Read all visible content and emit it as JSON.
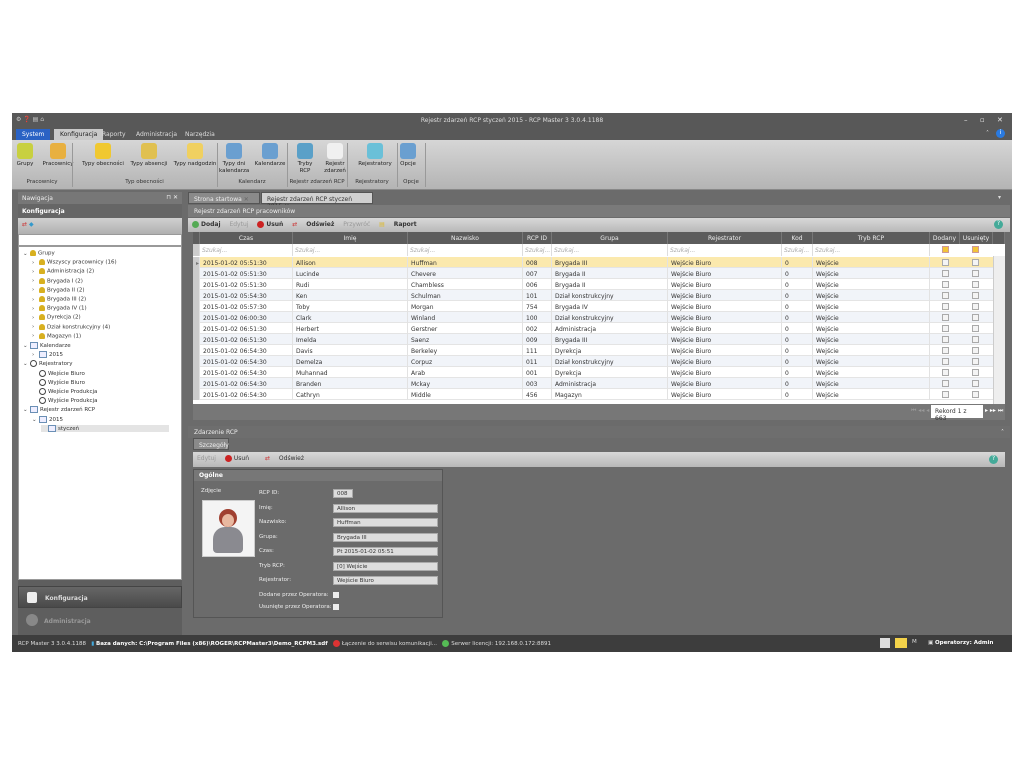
{
  "window": {
    "title": "Rejestr zdarzeń RCP styczeń 2015 - RCP Master 3 3.0.4.1188"
  },
  "ribbon": {
    "tabs": [
      "System",
      "Konfiguracja",
      "Raporty",
      "Administracja",
      "Narzędzia"
    ],
    "buttons": [
      {
        "label": "Grupy",
        "color": "#c8d040"
      },
      {
        "label": "Pracownicy",
        "color": "#e8b040"
      },
      {
        "label": "Typy obecności",
        "color": "#f0c830"
      },
      {
        "label": "Typy absencji",
        "color": "#e0c050"
      },
      {
        "label": "Typy nadgodzin",
        "color": "#f0d060"
      },
      {
        "label": "Typy dni kalendarza",
        "color": "#6a9fd0"
      },
      {
        "label": "Kalendarze",
        "color": "#6a9fd0"
      },
      {
        "label": "Tryby RCP",
        "color": "#5aa0c8"
      },
      {
        "label": "Rejestr zdarzeń",
        "color": "#f0f0f0"
      },
      {
        "label": "Rejestratory",
        "color": "#6ac0d8"
      },
      {
        "label": "Opcje",
        "color": "#6a9fd0"
      }
    ],
    "groups": [
      "Pracownicy",
      "Typ obecności",
      "Kalendarz",
      "Rejestr zdarzeń RCP",
      "Rejestratory",
      "Opcje"
    ]
  },
  "nav": {
    "title": "Nawigacja",
    "section": "Konfiguracja",
    "tree": [
      {
        "label": "Grupy",
        "level": 0,
        "icon": "users",
        "exp": "v"
      },
      {
        "label": "Wszyscy pracownicy (16)",
        "level": 1,
        "icon": "users",
        "exp": ">"
      },
      {
        "label": "Administracja (2)",
        "level": 1,
        "icon": "users",
        "exp": ">"
      },
      {
        "label": "Brygada I (2)",
        "level": 1,
        "icon": "users",
        "exp": ">"
      },
      {
        "label": "Brygada II (2)",
        "level": 1,
        "icon": "users",
        "exp": ">"
      },
      {
        "label": "Brygada III (2)",
        "level": 1,
        "icon": "users",
        "exp": ">"
      },
      {
        "label": "Brygada IV (1)",
        "level": 1,
        "icon": "users",
        "exp": ">"
      },
      {
        "label": "Dyrekcja (2)",
        "level": 1,
        "icon": "users",
        "exp": ">"
      },
      {
        "label": "Dział konstrukcyjny (4)",
        "level": 1,
        "icon": "users",
        "exp": ">"
      },
      {
        "label": "Magazyn (1)",
        "level": 1,
        "icon": "users",
        "exp": ">"
      },
      {
        "label": "Kalendarze",
        "level": 0,
        "icon": "calendar",
        "exp": "v"
      },
      {
        "label": "2015",
        "level": 1,
        "icon": "calendar",
        "exp": ">"
      },
      {
        "label": "Rejestratory",
        "level": 0,
        "icon": "reader",
        "exp": "v"
      },
      {
        "label": "Wejście Biuro",
        "level": 1,
        "icon": "reader",
        "exp": ""
      },
      {
        "label": "Wyjście Biuro",
        "level": 1,
        "icon": "reader",
        "exp": ""
      },
      {
        "label": "Wejście Produkcja",
        "level": 1,
        "icon": "reader",
        "exp": ""
      },
      {
        "label": "Wyjście Produkcja",
        "level": 1,
        "icon": "reader",
        "exp": ""
      },
      {
        "label": "Rejestr zdarzeń RCP",
        "level": 0,
        "icon": "calendar",
        "exp": "v"
      },
      {
        "label": "2015",
        "level": 1,
        "icon": "calendar",
        "exp": "v"
      },
      {
        "label": "styczeń",
        "level": 2,
        "icon": "calendar",
        "exp": ""
      }
    ],
    "bottom": [
      "Konfiguracja",
      "Administracja"
    ]
  },
  "tabs": [
    "Strona startowa",
    "Rejestr zdarzeń RCP styczeń 2015"
  ],
  "grid_section": "Rejestr zdarzeń RCP pracowników",
  "toolbar": {
    "add": "Dodaj",
    "edit": "Edytuj",
    "delete": "Usuń",
    "refresh": "Odśwież",
    "restore": "Przywróć",
    "report": "Raport"
  },
  "grid": {
    "columns": [
      "Czas",
      "Imię",
      "Nazwisko",
      "RCP ID",
      "Grupa",
      "Rejestrator",
      "Kod",
      "Tryb RCP",
      "Dodany",
      "Usunięty"
    ],
    "filter_placeholder": "Szukaj...",
    "rows": [
      [
        "2015-01-02 05:51:30",
        "Allison",
        "Huffman",
        "008",
        "Brygada III",
        "Wejście Biuro",
        "0",
        "Wejście"
      ],
      [
        "2015-01-02 05:51:30",
        "Lucinde",
        "Chevere",
        "007",
        "Brygada II",
        "Wejście Biuro",
        "0",
        "Wejście"
      ],
      [
        "2015-01-02 05:51:30",
        "Rudi",
        "Chambless",
        "006",
        "Brygada II",
        "Wejście Biuro",
        "0",
        "Wejście"
      ],
      [
        "2015-01-02 05:54:30",
        "Ken",
        "Schulman",
        "101",
        "Dział konstrukcyjny",
        "Wejście Biuro",
        "0",
        "Wejście"
      ],
      [
        "2015-01-02 05:57:30",
        "Toby",
        "Morgan",
        "754",
        "Brygada IV",
        "Wejście Biuro",
        "0",
        "Wejście"
      ],
      [
        "2015-01-02 06:00:30",
        "Clark",
        "Winland",
        "100",
        "Dział konstrukcyjny",
        "Wejście Biuro",
        "0",
        "Wejście"
      ],
      [
        "2015-01-02 06:51:30",
        "Herbert",
        "Gerstner",
        "002",
        "Administracja",
        "Wejście Biuro",
        "0",
        "Wejście"
      ],
      [
        "2015-01-02 06:51:30",
        "Imelda",
        "Saenz",
        "009",
        "Brygada III",
        "Wejście Biuro",
        "0",
        "Wejście"
      ],
      [
        "2015-01-02 06:54:30",
        "Davis",
        "Berkeley",
        "111",
        "Dyrekcja",
        "Wejście Biuro",
        "0",
        "Wejście"
      ],
      [
        "2015-01-02 06:54:30",
        "Demelza",
        "Corpuz",
        "011",
        "Dział konstrukcyjny",
        "Wejście Biuro",
        "0",
        "Wejście"
      ],
      [
        "2015-01-02 06:54:30",
        "Muhannad",
        "Arab",
        "001",
        "Dyrekcja",
        "Wejście Biuro",
        "0",
        "Wejście"
      ],
      [
        "2015-01-02 06:54:30",
        "Branden",
        "Mckay",
        "003",
        "Administracja",
        "Wejście Biuro",
        "0",
        "Wejście"
      ],
      [
        "2015-01-02 06:54:30",
        "Cathryn",
        "Middle",
        "456",
        "Magazyn",
        "Wejście Biuro",
        "0",
        "Wejście"
      ]
    ],
    "pager": "Rekord 1 z 663"
  },
  "detail": {
    "section": "Zdarzenie RCP",
    "tab": "Szczegóły",
    "toolbar": {
      "edit": "Edytuj",
      "delete": "Usuń",
      "refresh": "Odśwież"
    },
    "group": "Ogólne",
    "photo_label": "Zdjęcie",
    "fields": [
      {
        "label": "RCP ID:",
        "value": "008"
      },
      {
        "label": "Imię:",
        "value": "Allison"
      },
      {
        "label": "Nazwisko:",
        "value": "Huffman"
      },
      {
        "label": "Grupa:",
        "value": "Brygada III"
      },
      {
        "label": "Czas:",
        "value": "Pt 2015-01-02 05:51"
      },
      {
        "label": "Tryb RCP:",
        "value": "[0] Wejście"
      },
      {
        "label": "Rejestrator:",
        "value": "Wejście Biuro"
      }
    ],
    "checks": [
      "Dodane przez Operatora:",
      "Usunięte przez Operatora:"
    ]
  },
  "status": {
    "version": "RCP Master 3 3.0.4.1188",
    "db": "Baza danych: C:\\Program Files (x86)\\ROGER\\RCPMaster3\\Demo_RCPM3.sdf",
    "comm": "Łączenie do serwisu komunikacji...",
    "license": "Serwer licencji: 192.168.0.172:8891",
    "operators": "Operatorzy: Admin"
  },
  "colors": {
    "accent": "#2a62c4",
    "selected_row": "#fbe9ad"
  }
}
